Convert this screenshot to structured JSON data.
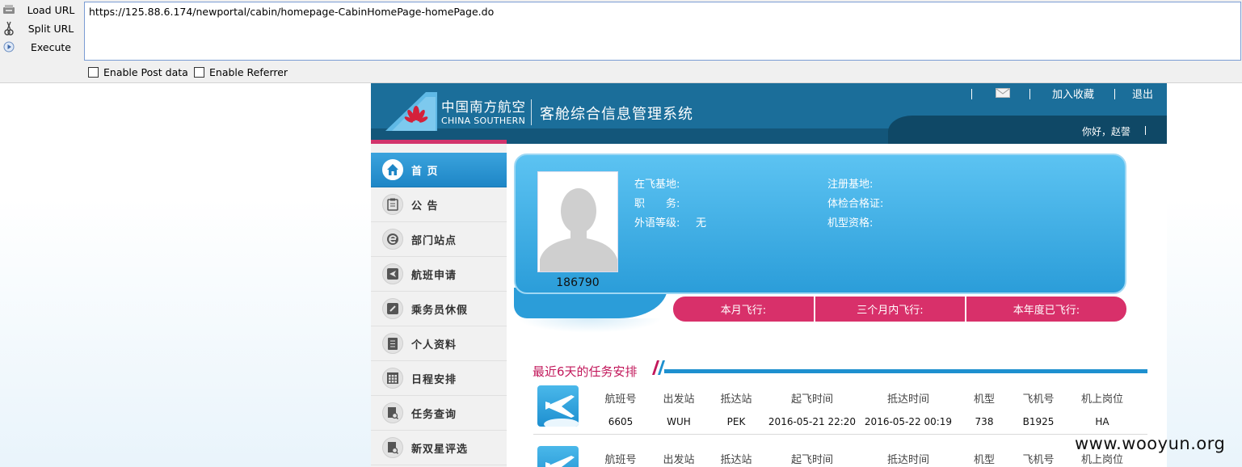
{
  "hackbar": {
    "load_url": "Load URL",
    "split_url": "Split URL",
    "execute": "Execute",
    "url_value": "https://125.88.6.174/newportal/cabin/homepage-CabinHomePage-homePage.do",
    "enable_post": "Enable Post data",
    "enable_referrer": "Enable Referrer"
  },
  "header": {
    "brand_cn": "中国南方航空",
    "brand_en": "CHINA SOUTHERN",
    "system_title": "客舱综合信息管理系统",
    "add_favorite": "加入收藏",
    "logout": "退出",
    "greeting": "你好，赵謦"
  },
  "sidebar": {
    "items": [
      {
        "label": "首 页",
        "icon": "home-icon"
      },
      {
        "label": "公 告",
        "icon": "clipboard-icon"
      },
      {
        "label": "部门站点",
        "icon": "ie-icon"
      },
      {
        "label": "航班申请",
        "icon": "flight-icon"
      },
      {
        "label": "乘务员休假",
        "icon": "link-icon"
      },
      {
        "label": "个人资料",
        "icon": "document-icon"
      },
      {
        "label": "日程安排",
        "icon": "calendar-icon"
      },
      {
        "label": "任务查询",
        "icon": "search-doc-icon"
      },
      {
        "label": "新双星评选",
        "icon": "search-doc-icon"
      }
    ]
  },
  "profile": {
    "employee_id": "186790",
    "fields": {
      "base_label": "在飞基地:",
      "reg_base_label": "注册基地:",
      "position_label": "职　　务:",
      "medical_label": "体检合格证:",
      "language_label": "外语等级:",
      "language_value": "无",
      "aircraft_label": "机型资格:"
    }
  },
  "stats": {
    "month": "本月飞行:",
    "three_months": "三个月内飞行:",
    "year": "本年度已飞行:"
  },
  "tasks": {
    "title": "最近6天的任务安排",
    "headers": [
      "航班号",
      "出发站",
      "抵达站",
      "起飞时间",
      "抵达时间",
      "机型",
      "飞机号",
      "机上岗位"
    ],
    "rows": [
      [
        "6605",
        "WUH",
        "PEK",
        "2016-05-21 22:20",
        "2016-05-22 00:19",
        "738",
        "B1925",
        "HA"
      ]
    ]
  },
  "watermark": "www.wooyun.org",
  "colors": {
    "header_blue": "#1b6e9a",
    "accent_pink": "#d8306a",
    "card_blue": "#2b9dd9",
    "title_magenta": "#c2185b"
  }
}
